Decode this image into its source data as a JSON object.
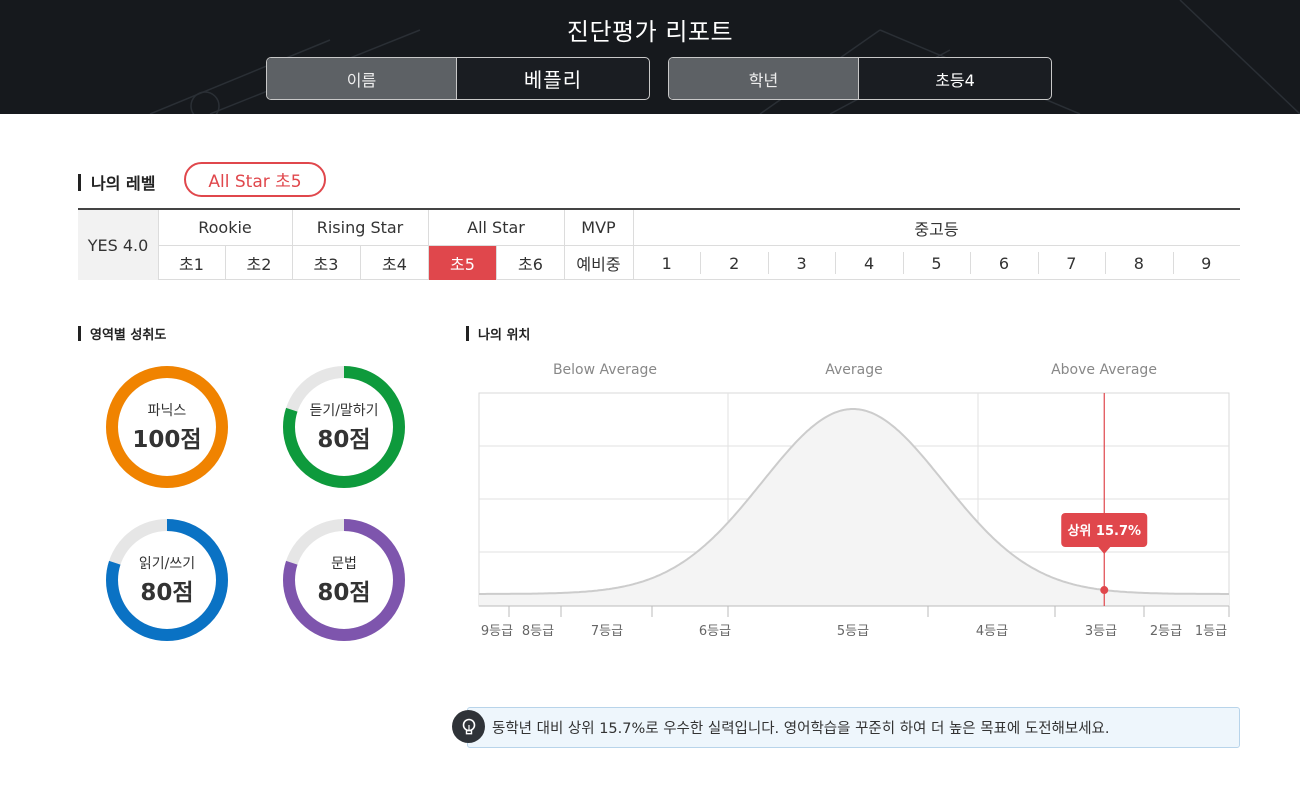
{
  "header": {
    "title": "진단평가 리포트",
    "name_label": "이름",
    "name_value": "베플리",
    "grade_label": "학년",
    "grade_value": "초등4"
  },
  "my_level": {
    "section_title": "나의 레벨",
    "badge": "All Star 초5"
  },
  "level_table": {
    "version": "YES 4.0",
    "groups": [
      {
        "name": "Rookie",
        "levels": [
          "초1",
          "초2"
        ]
      },
      {
        "name": "Rising Star",
        "levels": [
          "초3",
          "초4"
        ]
      },
      {
        "name": "All Star",
        "levels": [
          "초5",
          "초6"
        ]
      },
      {
        "name": "MVP",
        "levels": [
          "예비중"
        ]
      },
      {
        "name": "중고등",
        "levels": [
          "1",
          "2",
          "3",
          "4",
          "5",
          "6",
          "7",
          "8",
          "9"
        ]
      }
    ],
    "active_level": "초5"
  },
  "achievement": {
    "section_title": "영역별 성취도",
    "items": [
      {
        "label": "파닉스",
        "score_text": "100점",
        "score": 100,
        "color": "#f08300"
      },
      {
        "label": "듣기/말하기",
        "score_text": "80점",
        "score": 80,
        "color": "#0e9a3c"
      },
      {
        "label": "읽기/쓰기",
        "score_text": "80점",
        "score": 80,
        "color": "#0a72c4"
      },
      {
        "label": "문법",
        "score_text": "80점",
        "score": 80,
        "color": "#7e55ad"
      }
    ],
    "track_color": "#e6e6e6"
  },
  "position": {
    "section_title": "나의 위치",
    "categories": [
      "Below Average",
      "Average",
      "Above Average"
    ],
    "grade_labels": [
      "9등급",
      "8등급",
      "7등급",
      "6등급",
      "5등급",
      "4등급",
      "3등급",
      "2등급",
      "1등급"
    ],
    "marker_label": "상위 15.7%",
    "marker_percentile": 15.7,
    "accent_color": "#e0474c"
  },
  "tip": {
    "message": "동학년 대비 상위 15.7%로 우수한 실력입니다. 영어학습을 꾸준히 하여 더 높은 목표에 도전해보세요."
  }
}
